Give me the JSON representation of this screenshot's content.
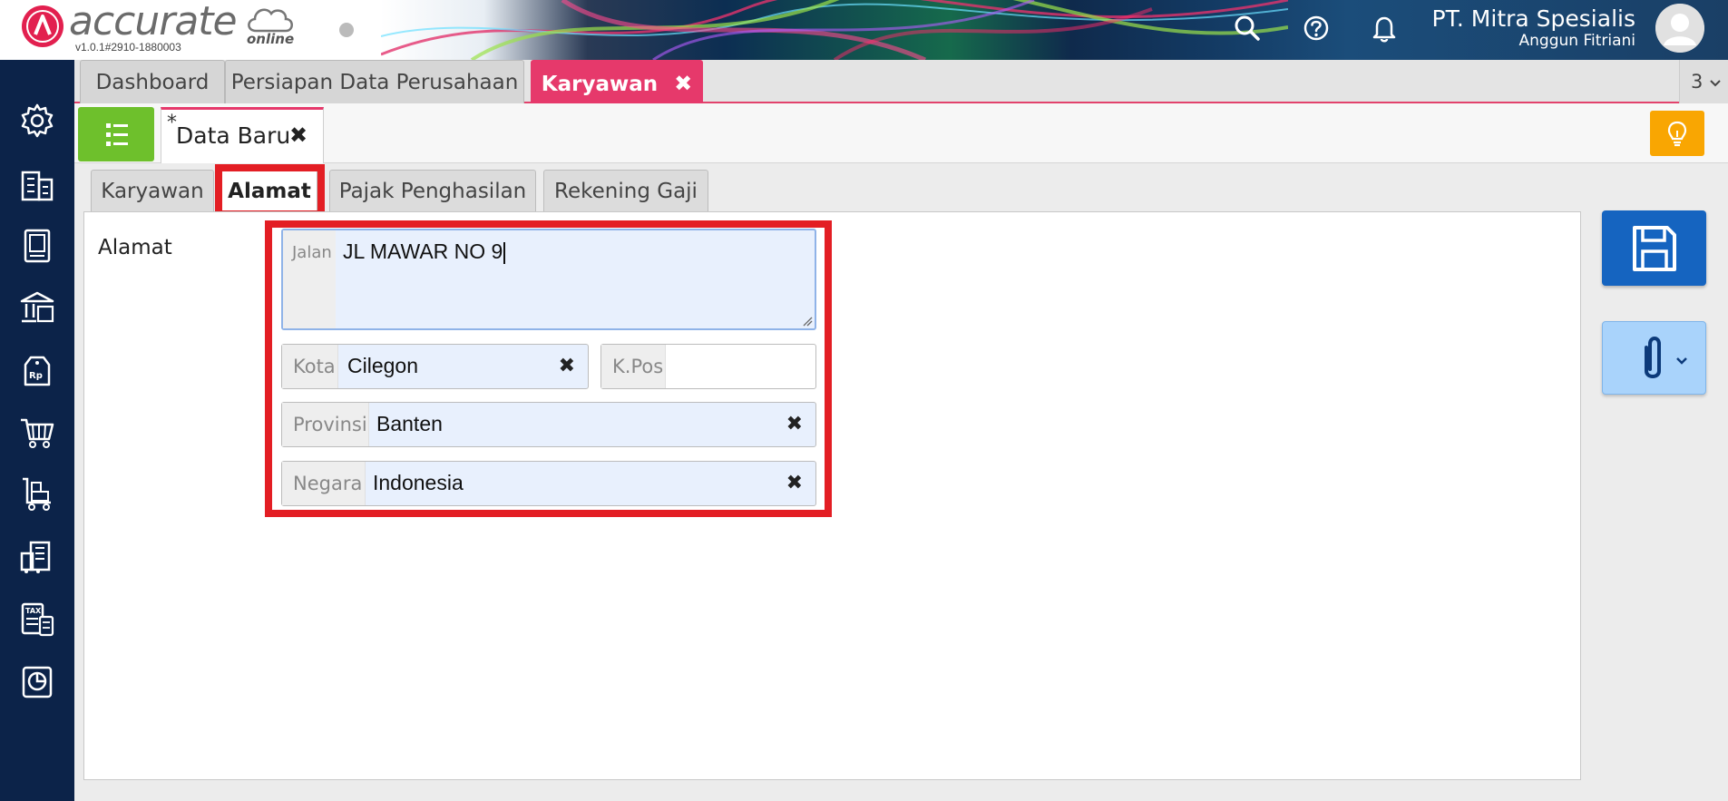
{
  "header": {
    "brand": "accurate",
    "brand_sub": "online",
    "version": "v1.0.1#2910-1880003",
    "company": "PT. Mitra Spesialis",
    "user": "Anggun Fitriani",
    "icons": [
      "search-icon",
      "help-icon",
      "bell-icon",
      "avatar-icon"
    ]
  },
  "doc_tabs": {
    "items": [
      {
        "label": "Dashboard"
      },
      {
        "label": "Persiapan Data Perusahaan"
      },
      {
        "label": "Karyawan",
        "active": true
      }
    ],
    "close": "✖",
    "count": "3"
  },
  "subbar": {
    "tab_star": "*",
    "tab_label": "Data Baru",
    "tab_close": "✖"
  },
  "form_tabs": {
    "items": [
      {
        "label": "Karyawan"
      },
      {
        "label": "Alamat",
        "active": true
      },
      {
        "label": "Pajak Penghasilan"
      },
      {
        "label": "Rekening Gaji"
      }
    ]
  },
  "form": {
    "section_label": "Alamat",
    "jalan": {
      "label": "Jalan",
      "value": "JL MAWAR NO 9"
    },
    "kota": {
      "label": "Kota",
      "value": "Cilegon"
    },
    "kpos": {
      "label": "K.Pos",
      "value": ""
    },
    "provinsi": {
      "label": "Provinsi",
      "value": "Banten"
    },
    "negara": {
      "label": "Negara",
      "value": "Indonesia"
    },
    "clear": "✖"
  },
  "sidebar": {
    "icons": [
      "gear-icon",
      "building-icon",
      "book-icon",
      "bank-icon",
      "price-tag-icon",
      "cart-icon",
      "shipping-cart-icon",
      "factory-icon",
      "tax-icon",
      "report-icon"
    ]
  },
  "colors": {
    "brand_pink": "#e6396b",
    "sidebar_navy": "#0c2349",
    "list_green": "#6ec02c",
    "save_blue": "#1564c0",
    "highlight_red": "#e31e24",
    "bulb_orange": "#f9a602"
  }
}
